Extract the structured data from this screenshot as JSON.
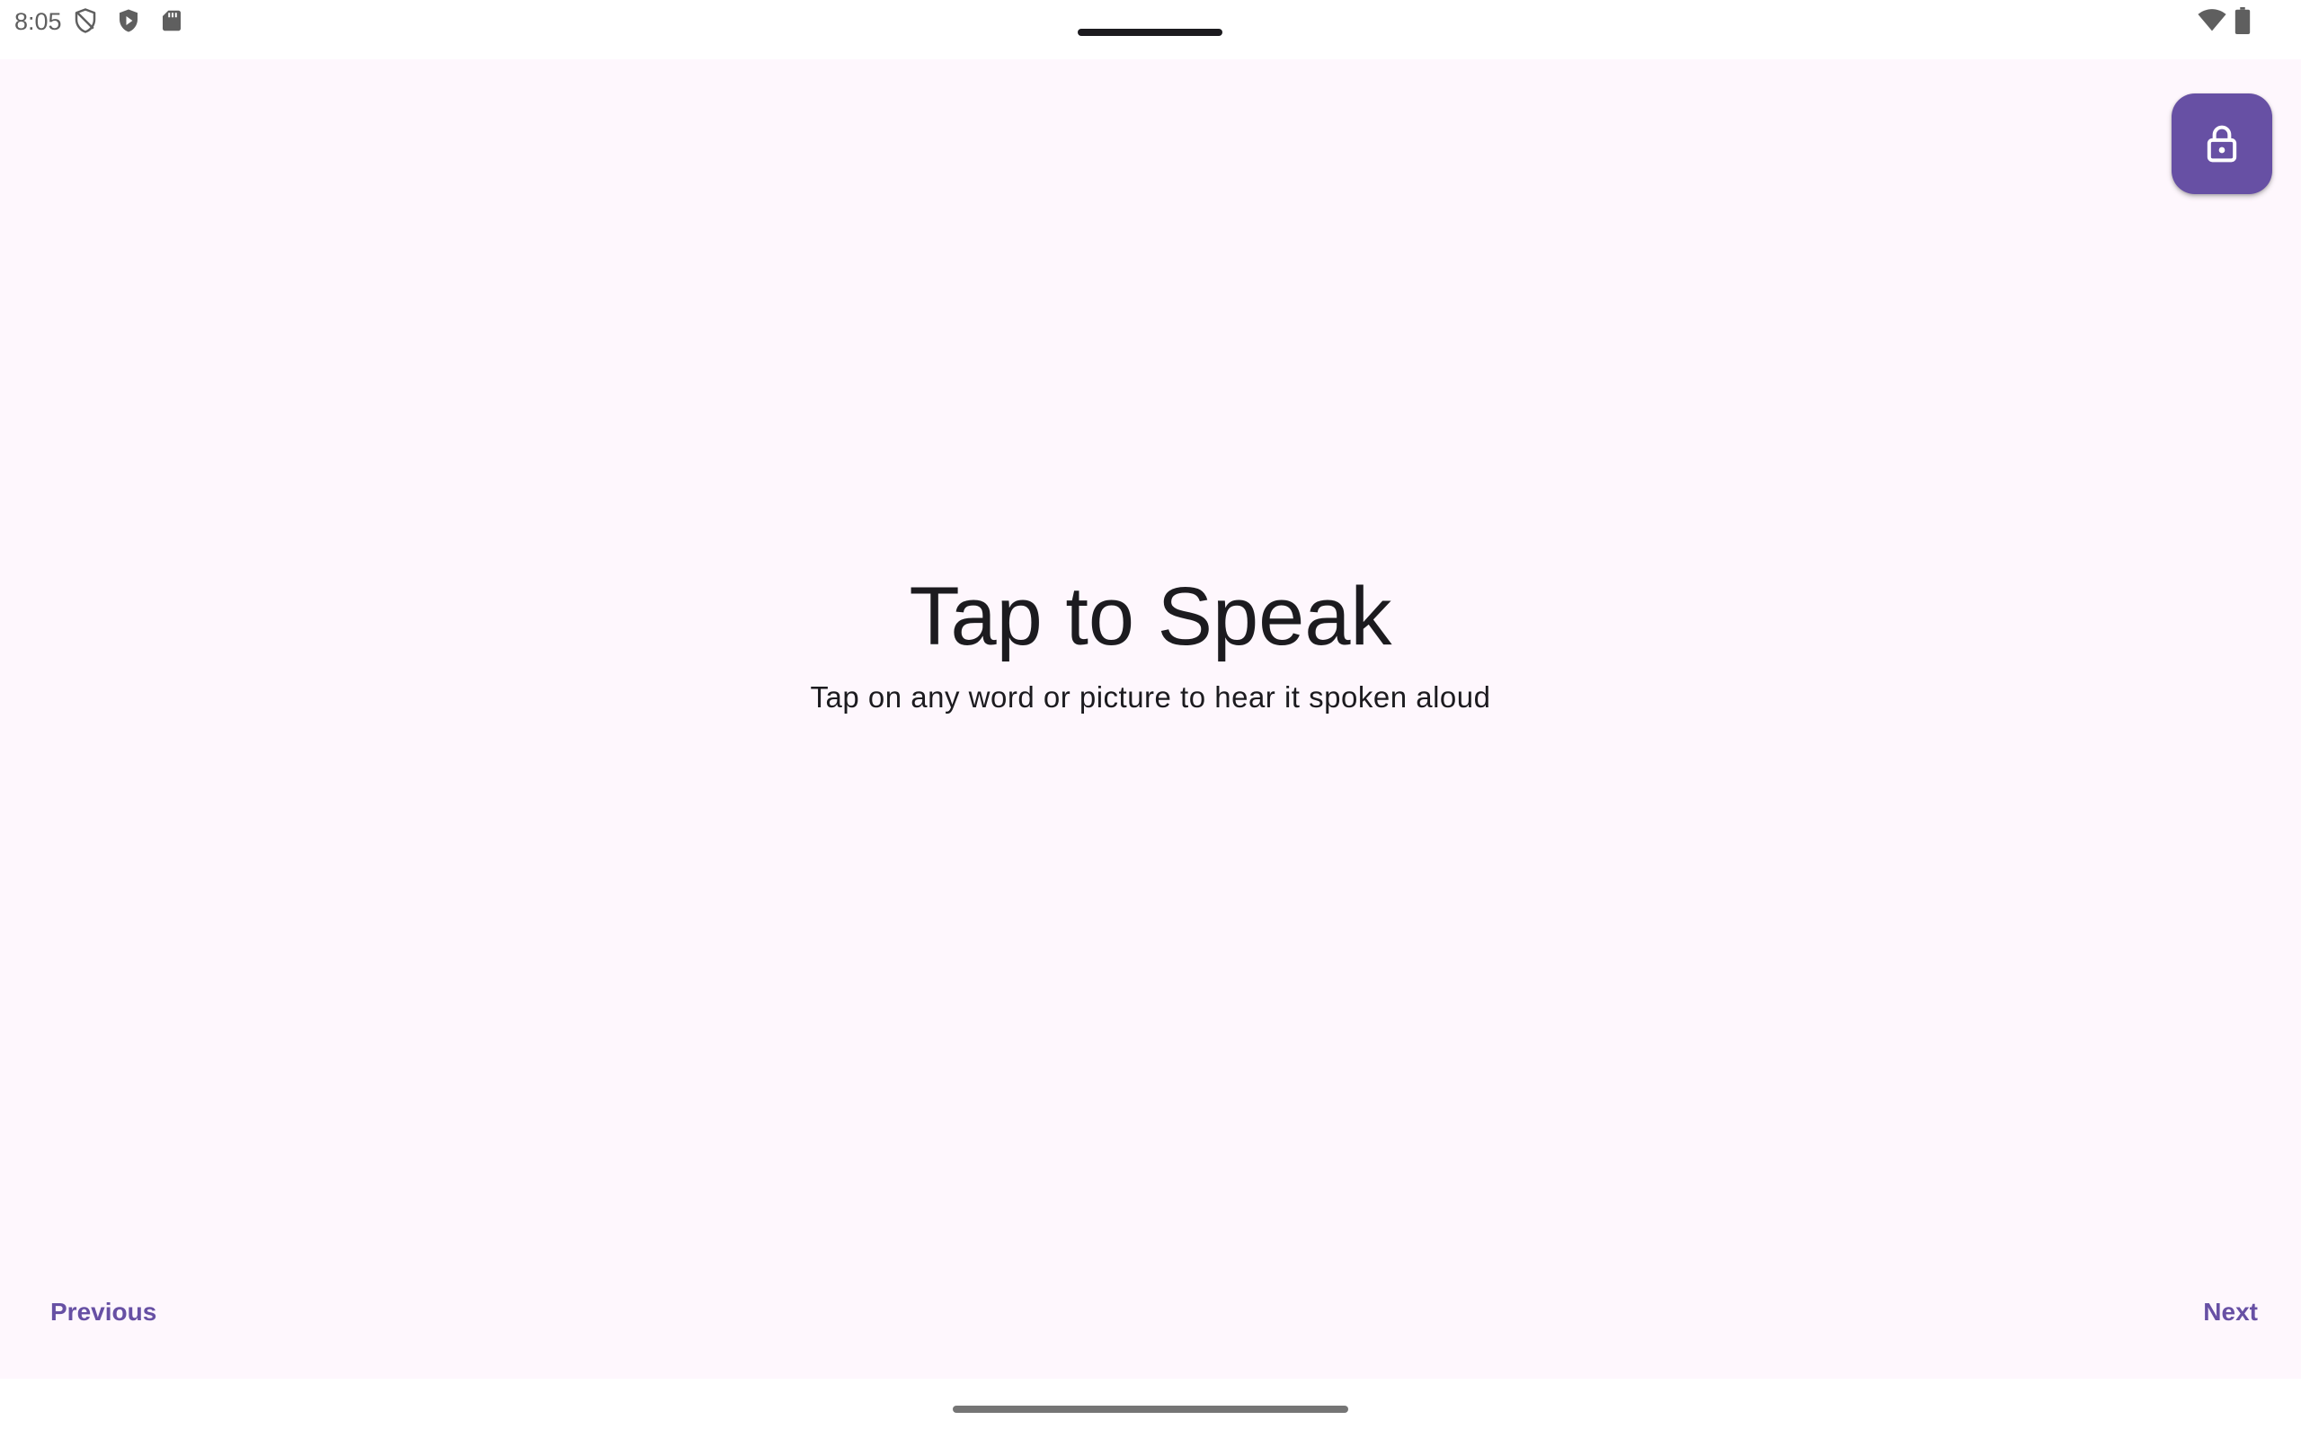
{
  "status_bar": {
    "time": "8:05",
    "left_icons": [
      "shield-outline-icon",
      "play-protect-icon",
      "sd-card-icon"
    ],
    "right_icons": [
      "wifi-icon",
      "battery-icon"
    ]
  },
  "colors": {
    "surface": "#fef7fd",
    "accent": "#6750a4",
    "text": "#1c1b1f"
  },
  "lock_button": {
    "icon": "lock-open-icon"
  },
  "main": {
    "title": "Tap to Speak",
    "subtitle": "Tap on any word or picture to hear it spoken aloud"
  },
  "navigation": {
    "previous_label": "Previous",
    "next_label": "Next"
  }
}
